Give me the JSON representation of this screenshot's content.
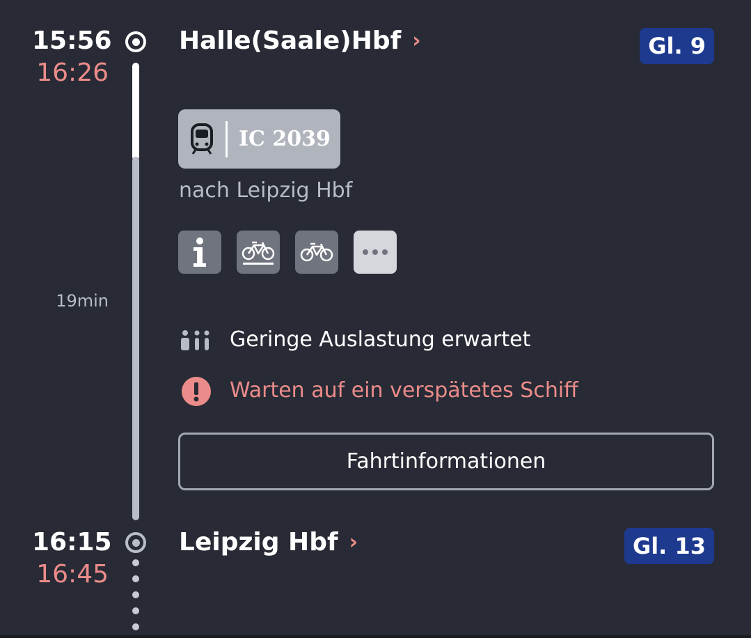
{
  "departure": {
    "time_planned": "15:56",
    "time_actual": "16:26",
    "station": "Halle(Saale)Hbf",
    "station_chevron": "›",
    "platform": "Gl. 9"
  },
  "train": {
    "icon": "train-icon",
    "number": "IC 2039",
    "destination": "nach Leipzig Hbf",
    "features": [
      {
        "icon": "info-icon"
      },
      {
        "icon": "bike-reservation-icon"
      },
      {
        "icon": "bike-icon"
      },
      {
        "icon": "more-icon"
      }
    ]
  },
  "duration": "19min",
  "occupancy": {
    "icon": "occupancy-icon",
    "text": "Geringe Auslastung erwartet"
  },
  "warning": {
    "icon": "warning-icon",
    "text": "Warten auf ein verspätetes Schiff"
  },
  "trip_info_button": "Fahrtinformationen",
  "arrival": {
    "time_planned": "16:15",
    "time_actual": "16:45",
    "station": "Leipzig Hbf",
    "station_chevron": "›",
    "platform": "Gl. 13"
  },
  "colors": {
    "background": "#282b35",
    "delay": "#ec8c8a",
    "platform_badge": "#1e3a8f"
  }
}
